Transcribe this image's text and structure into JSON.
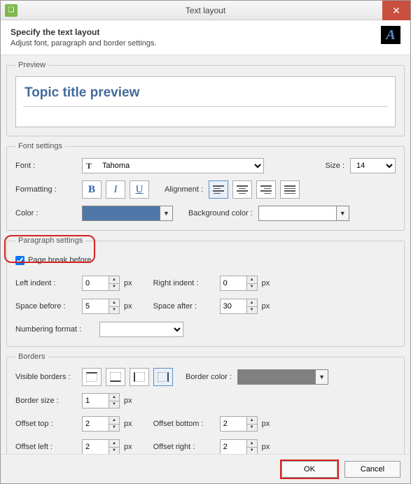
{
  "window": {
    "title": "Text layout"
  },
  "header": {
    "title": "Specify the text layout",
    "subtitle": "Adjust font, paragraph and border settings."
  },
  "preview": {
    "legend": "Preview",
    "text": "Topic title preview"
  },
  "font": {
    "legend": "Font settings",
    "font_label": "Font :",
    "font_value": "Tahoma",
    "size_label": "Size :",
    "size_value": "14",
    "formatting_label": "Formatting :",
    "alignment_label": "Alignment :",
    "color_label": "Color :",
    "color_value": "#4f77a8",
    "bgcolor_label": "Background color :",
    "bgcolor_value": "#ffffff"
  },
  "paragraph": {
    "legend": "Paragraph settings",
    "page_break_label": "Page break before",
    "page_break_checked": true,
    "left_indent_label": "Left indent :",
    "left_indent_value": "0",
    "right_indent_label": "Right indent :",
    "right_indent_value": "0",
    "space_before_label": "Space before :",
    "space_before_value": "5",
    "space_after_label": "Space after :",
    "space_after_value": "30",
    "numfmt_label": "Numbering format :",
    "numfmt_value": "",
    "unit": "px"
  },
  "borders": {
    "legend": "Borders",
    "visible_label": "Visible borders :",
    "color_label": "Border color :",
    "color_value": "#808080",
    "size_label": "Border size :",
    "size_value": "1",
    "offset_top_label": "Offset top :",
    "offset_top_value": "2",
    "offset_bottom_label": "Offset bottom :",
    "offset_bottom_value": "2",
    "offset_left_label": "Offset left :",
    "offset_left_value": "2",
    "offset_right_label": "Offset right :",
    "offset_right_value": "2",
    "unit": "px"
  },
  "footer": {
    "ok": "OK",
    "cancel": "Cancel"
  }
}
